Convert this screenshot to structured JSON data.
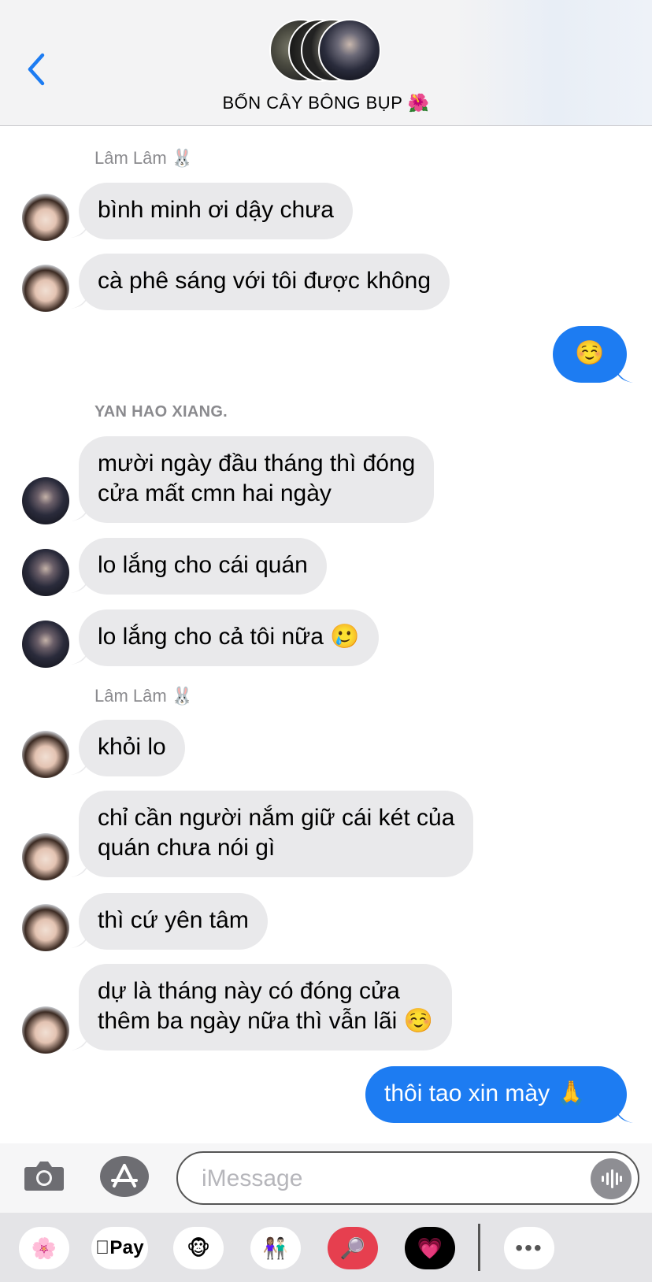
{
  "header": {
    "group_name": "BỐN CÂY BÔNG BỤP 🌺",
    "back_icon": "chevron-left-icon",
    "accent": "#1d7cf2"
  },
  "messages": [
    {
      "sender_label": "Lâm Lâm 🐰"
    },
    {
      "text": "bình minh ơi dậy chưa"
    },
    {
      "text": "cà phê sáng với tôi được không"
    },
    {
      "text": "☺️"
    },
    {
      "sender_label": "YAN HAO XIANG."
    },
    {
      "text": "mười ngày đầu tháng thì đóng\ncửa mất cmn hai ngày"
    },
    {
      "text": "lo lắng cho cái quán"
    },
    {
      "text": "lo lắng cho cả tôi nữa 🥲"
    },
    {
      "sender_label": "Lâm Lâm 🐰"
    },
    {
      "text": "khỏi lo"
    },
    {
      "text": "chỉ cần người nắm giữ cái két của\nquán chưa nói gì"
    },
    {
      "text": "thì cứ yên tâm"
    },
    {
      "text": "dự là tháng này có đóng cửa\nthêm ba ngày nữa thì vẫn lãi ☺️"
    },
    {
      "text": "thôi tao xin mày 🙏"
    }
  ],
  "composer": {
    "placeholder": "iMessage",
    "camera_icon": "camera-icon",
    "apps_icon": "app-store-icon",
    "mic_icon": "audio-waveform-icon"
  },
  "app_drawer": {
    "photos": "🌸",
    "apple_pay": "Pay",
    "animoji": "🐵",
    "memoji": "👩🏽‍🤝‍👨🏻",
    "search": "🔎",
    "digital_touch": "💗",
    "more": "•••"
  },
  "colors": {
    "received_bubble": "#e9e9eb",
    "sent_bubble": "#1d7cf2"
  }
}
